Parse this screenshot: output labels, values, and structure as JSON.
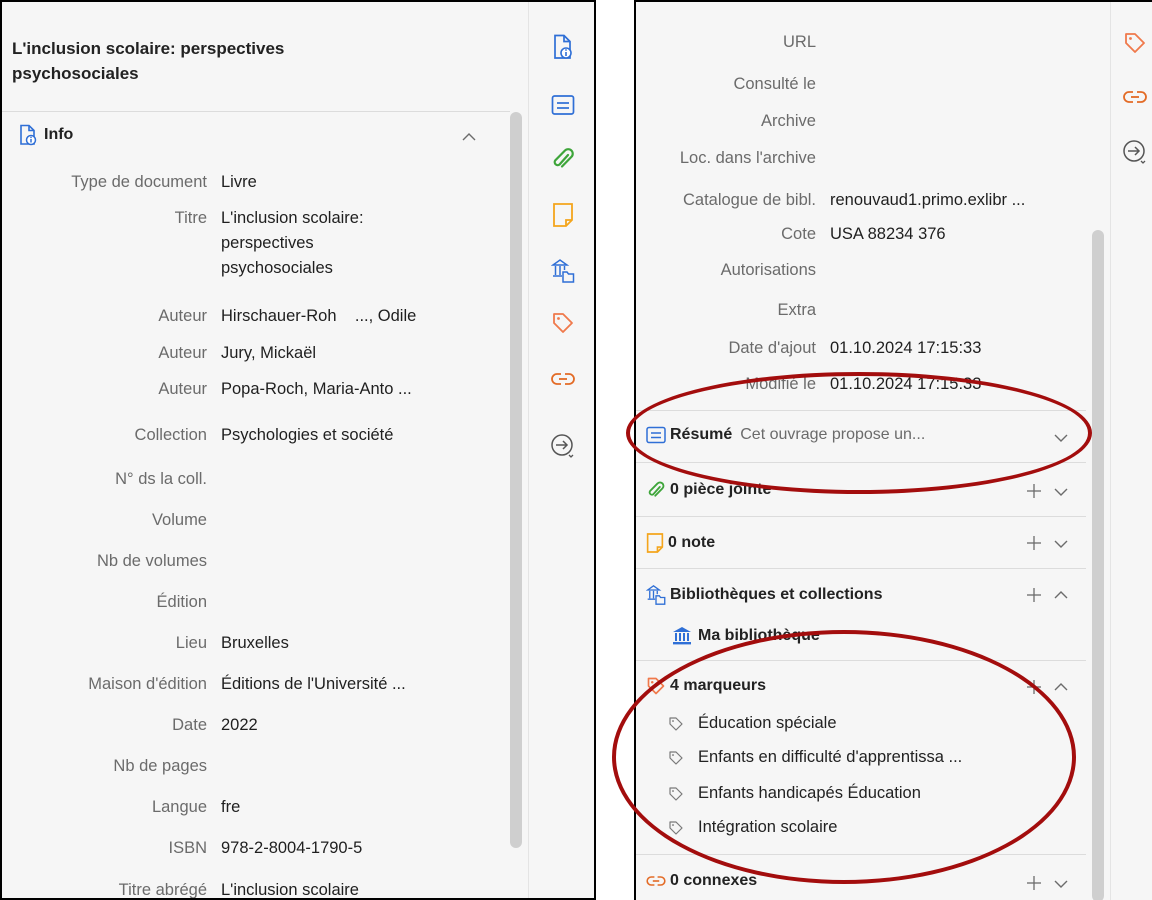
{
  "left": {
    "title": "L'inclusion scolaire: perspectives psychosociales",
    "section_label": "Info",
    "fields": [
      {
        "label": "Type de document",
        "value": "Livre"
      },
      {
        "label": "Titre",
        "value": "L'inclusion scolaire:\nperspectives\npsychosociales"
      },
      {
        "label": "Auteur",
        "value": "Hirschauer-Roh    ..., Odile"
      },
      {
        "label": "Auteur",
        "value": "Jury, Mickaël"
      },
      {
        "label": "Auteur",
        "value": "Popa-Roch, Maria-Anto ..."
      },
      {
        "label": "Collection",
        "value": "Psychologies et société"
      },
      {
        "label": "N° ds la coll.",
        "value": ""
      },
      {
        "label": "Volume",
        "value": ""
      },
      {
        "label": "Nb de volumes",
        "value": ""
      },
      {
        "label": "Édition",
        "value": ""
      },
      {
        "label": "Lieu",
        "value": "Bruxelles"
      },
      {
        "label": "Maison d'édition",
        "value": "Éditions de l'Université ..."
      },
      {
        "label": "Date",
        "value": "2022"
      },
      {
        "label": "Nb de pages",
        "value": ""
      },
      {
        "label": "Langue",
        "value": "fre"
      },
      {
        "label": "ISBN",
        "value": "978-2-8004-1790-5"
      },
      {
        "label": "Titre abrégé",
        "value": "L'inclusion scolaire"
      }
    ]
  },
  "right": {
    "fields": [
      {
        "label": "URL",
        "value": ""
      },
      {
        "label": "Consulté le",
        "value": ""
      },
      {
        "label": "Archive",
        "value": ""
      },
      {
        "label": "Loc. dans l'archive",
        "value": ""
      },
      {
        "label": "Catalogue de bibl.",
        "value": "renouvaud1.primo.exlibr ..."
      },
      {
        "label": "Cote",
        "value": "USA 88234 376"
      },
      {
        "label": "Autorisations",
        "value": ""
      },
      {
        "label": "Extra",
        "value": ""
      },
      {
        "label": "Date d'ajout",
        "value": "01.10.2024 17:15:33"
      },
      {
        "label": "Modifié le",
        "value": "01.10.2024 17:15:33"
      }
    ],
    "abstract": {
      "label": "Résumé",
      "preview": "Cet ouvrage propose un..."
    },
    "attachments_label": "0 pièce jointe",
    "notes_label": "0 note",
    "libraries_label": "Bibliothèques et collections",
    "library_item": "Ma bibliothèque",
    "tags_label": "4 marqueurs",
    "tags": [
      "Éducation spéciale",
      "Enfants en difficulté d'apprentissa ...",
      "Enfants handicapés Éducation",
      "Intégration scolaire"
    ],
    "related_label": "0 connexes"
  },
  "colors": {
    "info_blue": "#2f6fd6",
    "attachment_green": "#3ea53a",
    "note_orange": "#f4a51c",
    "tag_orange": "#f0794b",
    "link_orange": "#e36b26",
    "annotation_red": "#a30d0d"
  },
  "icons": [
    "info-icon",
    "abstract-icon",
    "attachment-icon",
    "note-icon",
    "libraries-icon",
    "tag-icon",
    "related-icon",
    "locate-icon",
    "library-icon",
    "chevron-up-icon",
    "chevron-down-icon",
    "plus-icon"
  ]
}
